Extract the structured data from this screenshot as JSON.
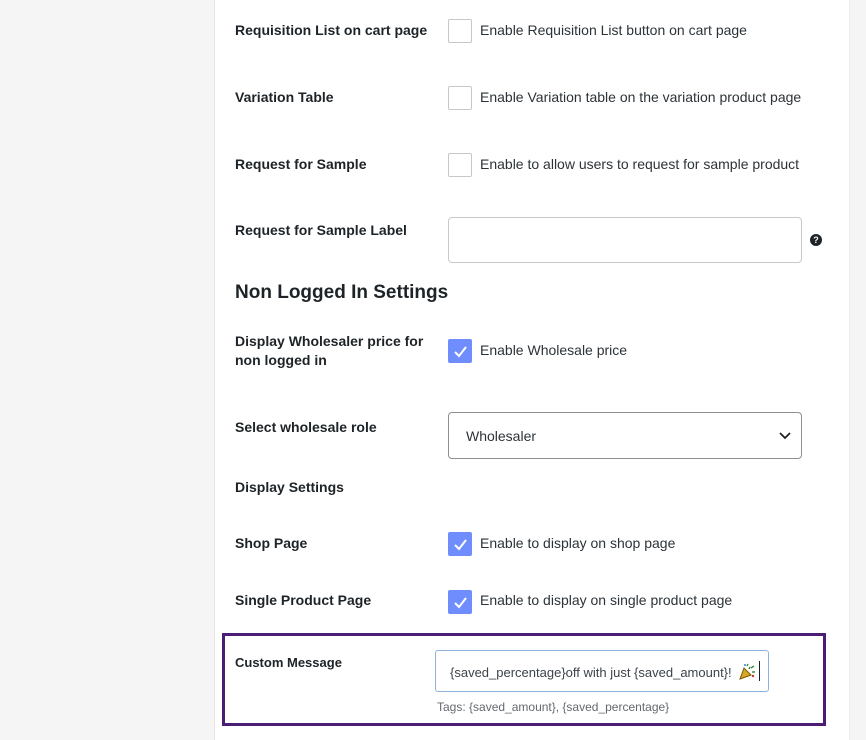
{
  "rows": {
    "requisition": {
      "label": "Requisition List on cart page",
      "checkbox_label": "Enable Requisition List button on cart page",
      "checked": false
    },
    "variation": {
      "label": "Variation Table",
      "checkbox_label": "Enable Variation table on the variation product page",
      "checked": false
    },
    "sample": {
      "label": "Request for Sample",
      "checkbox_label": "Enable to allow users to request for sample product",
      "checked": false
    },
    "sample_label": {
      "label": "Request for Sample Label",
      "value": "",
      "help": "?"
    }
  },
  "non_logged": {
    "title": "Non Logged In Settings",
    "wholesaler_price": {
      "label_line1": "Display Wholesaler price for",
      "label_line2": "non logged in",
      "checkbox_label": "Enable Wholesale price",
      "checked": true
    },
    "role": {
      "label": "Select wholesale role",
      "selected": "Wholesaler"
    },
    "display_settings": {
      "label": "Display Settings"
    },
    "shop_page": {
      "label": "Shop Page",
      "checkbox_label": "Enable to display on shop page",
      "checked": true
    },
    "single_product": {
      "label": "Single Product Page",
      "checkbox_label": "Enable to display on single product page",
      "checked": true
    }
  },
  "custom_message": {
    "label": "Custom Message",
    "value": "{saved_percentage}off with just {saved_amount}!",
    "emoji": "party-popper-icon",
    "tags": "Tags: {saved_amount}, {saved_percentage}"
  },
  "colors": {
    "accent": "#6f8dfc",
    "highlight_border": "#4c1d74",
    "input_focus": "#8fb2dc"
  }
}
